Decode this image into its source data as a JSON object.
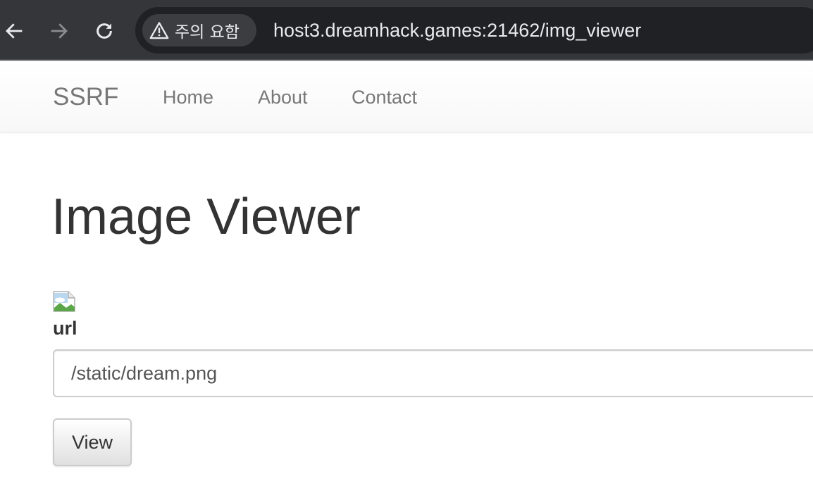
{
  "browser": {
    "security_label": "주의 요함",
    "url": "host3.dreamhack.games:21462/img_viewer",
    "icons": {
      "back": "arrow-left-icon",
      "forward": "arrow-right-icon",
      "reload": "reload-icon",
      "warning": "warning-triangle-icon"
    },
    "colors": {
      "chrome_bg": "#35363a",
      "omnibox_bg": "#202124",
      "text": "#e8eaed",
      "forward_disabled": "#8a8b8f"
    }
  },
  "navbar": {
    "brand": "SSRF",
    "links": [
      {
        "label": "Home"
      },
      {
        "label": "About"
      },
      {
        "label": "Contact"
      }
    ]
  },
  "main": {
    "title": "Image Viewer",
    "image_icon": "broken-image-icon",
    "url_label": "url",
    "url_input": {
      "value": "/static/dream.png"
    },
    "view_button": "View"
  }
}
